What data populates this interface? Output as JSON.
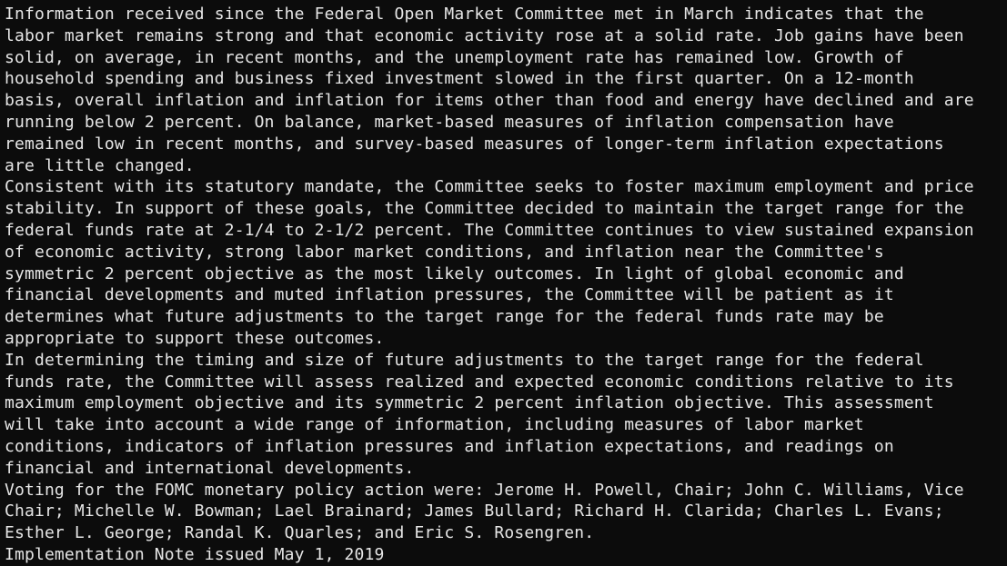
{
  "terminal": {
    "lines": [
      "Information received since the Federal Open Market Committee met in March indicates that the",
      "labor market remains strong and that economic activity rose at a solid rate. Job gains have been",
      "solid, on average, in recent months, and the unemployment rate has remained low. Growth of",
      "household spending and business fixed investment slowed in the first quarter. On a 12-month",
      "basis, overall inflation and inflation for items other than food and energy have declined and are",
      "running below 2 percent. On balance, market-based measures of inflation compensation have",
      "remained low in recent months, and survey-based measures of longer-term inflation expectations",
      "are little changed.",
      "Consistent with its statutory mandate, the Committee seeks to foster maximum employment and price",
      "stability. In support of these goals, the Committee decided to maintain the target range for the",
      "federal funds rate at 2-1/4 to 2-1/2 percent. The Committee continues to view sustained expansion",
      "of economic activity, strong labor market conditions, and inflation near the Committee's",
      "symmetric 2 percent objective as the most likely outcomes. In light of global economic and",
      "financial developments and muted inflation pressures, the Committee will be patient as it",
      "determines what future adjustments to the target range for the federal funds rate may be",
      "appropriate to support these outcomes.",
      "In determining the timing and size of future adjustments to the target range for the federal",
      "funds rate, the Committee will assess realized and expected economic conditions relative to its",
      "maximum employment objective and its symmetric 2 percent inflation objective. This assessment",
      "will take into account a wide range of information, including measures of labor market",
      "conditions, indicators of inflation pressures and inflation expectations, and readings on",
      "financial and international developments.",
      "Voting for the FOMC monetary policy action were: Jerome H. Powell, Chair; John C. Williams, Vice",
      "Chair; Michelle W. Bowman; Lael Brainard; James Bullard; Richard H. Clarida; Charles L. Evans;",
      "Esther L. George; Randal K. Quarles; and Eric S. Rosengren.",
      "Implementation Note issued May 1, 2019"
    ]
  },
  "colors": {
    "background": "#0c0c0c",
    "text": "#e6e6e6"
  }
}
